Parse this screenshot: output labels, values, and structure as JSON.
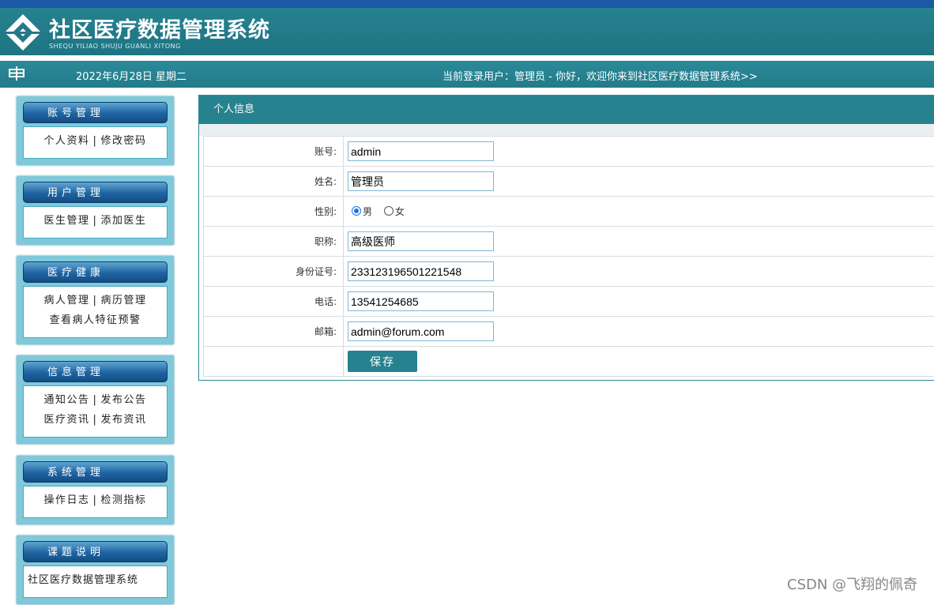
{
  "header": {
    "title": "社区医疗数据管理系统",
    "subtitle": "SHEQU YILIAO SHUJU GUANLI XITONG",
    "brand_color": "#26828f"
  },
  "subbar": {
    "date": "2022年6月28日 星期二",
    "welcome": "当前登录用户：管理员 - 你好，欢迎你来到社区医疗数据管理系统>>"
  },
  "menu": [
    {
      "title": "账号管理",
      "rows": [
        [
          "个人资料",
          "修改密码"
        ]
      ]
    },
    {
      "title": "用户管理",
      "rows": [
        [
          "医生管理",
          "添加医生"
        ]
      ]
    },
    {
      "title": "医疗健康",
      "rows": [
        [
          "病人管理",
          "病历管理"
        ],
        [
          "查看病人特征预警"
        ]
      ]
    },
    {
      "title": "信息管理",
      "rows": [
        [
          "通知公告",
          "发布公告"
        ],
        [
          "医疗资讯",
          "发布资讯"
        ]
      ]
    },
    {
      "title": "系统管理",
      "rows": [
        [
          "操作日志",
          "检测指标"
        ]
      ]
    },
    {
      "title": "课题说明",
      "rows": [
        [
          "社区医疗数据管理系统"
        ]
      ]
    }
  ],
  "panel": {
    "title": "个人信息",
    "fields": {
      "account": {
        "label": "账号:",
        "value": "admin"
      },
      "name": {
        "label": "姓名:",
        "value": "管理员"
      },
      "gender": {
        "label": "性别:",
        "options": [
          "男",
          "女"
        ],
        "selected": "男"
      },
      "title": {
        "label": "职称:",
        "value": "高级医师"
      },
      "id_number": {
        "label": "身份证号:",
        "value": "233123196501221548"
      },
      "phone": {
        "label": "电话:",
        "value": "13541254685"
      },
      "email": {
        "label": "邮箱:",
        "value": "admin@forum.com"
      }
    },
    "save_label": "保存"
  },
  "watermark": "CSDN @飞翔的佩奇"
}
